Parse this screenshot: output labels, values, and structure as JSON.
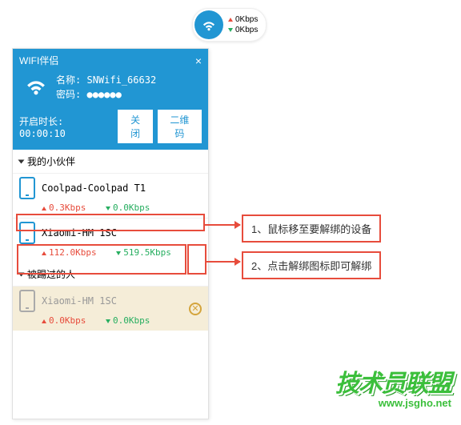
{
  "status_pill": {
    "up": "0Kbps",
    "down": "0Kbps"
  },
  "window": {
    "title": "WIFI伴侣",
    "name_label": "名称:",
    "name_value": "SNWifi_66632",
    "pwd_label": "密码:",
    "pwd_value": "●●●●●●",
    "uptime_label": "开启时长:",
    "uptime_value": "00:00:10",
    "btn_close": "关闭",
    "btn_qr": "二维码"
  },
  "sections": {
    "partners": "我的小伙伴",
    "kicked": "被踢过的人"
  },
  "devices": {
    "coolpad": {
      "name": "Coolpad-Coolpad T1",
      "up": "0.3Kbps",
      "down": "0.0Kbps"
    },
    "xiaomi1": {
      "name": "Xiaomi-HM 1SC",
      "up": "112.0Kbps",
      "down": "519.5Kbps"
    },
    "xiaomi2": {
      "name": "Xiaomi-HM 1SC",
      "up": "0.0Kbps",
      "down": "0.0Kbps"
    }
  },
  "callouts": {
    "c1": "1、鼠标移至要解绑的设备",
    "c2": "2、点击解绑图标即可解绑"
  },
  "watermark": {
    "brand": "技术员联盟",
    "url": "www.jsgho.net"
  }
}
